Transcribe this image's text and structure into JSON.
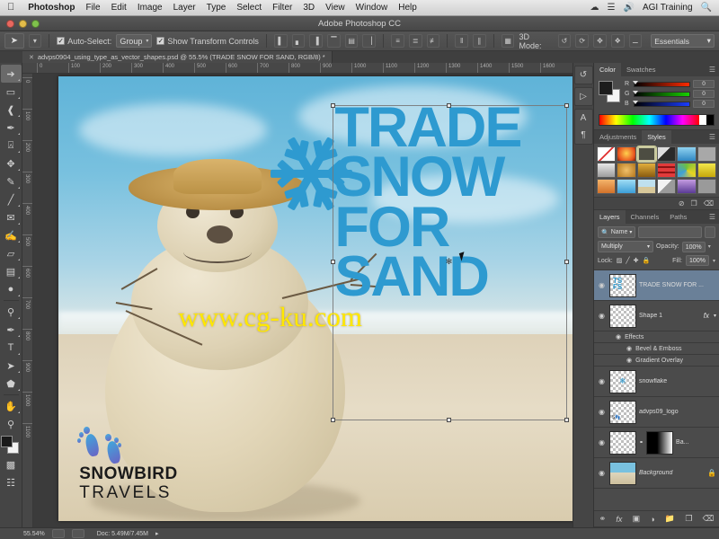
{
  "macbar": {
    "apple_icon": "apple-icon",
    "items": [
      "Photoshop",
      "File",
      "Edit",
      "Image",
      "Layer",
      "Type",
      "Select",
      "Filter",
      "3D",
      "View",
      "Window",
      "Help"
    ],
    "right": {
      "cloud_icon": "cloud-icon",
      "signal_icon": "signal-icon",
      "volume_icon": "volume-icon",
      "user": "AGI Training",
      "search_icon": "search-icon"
    }
  },
  "window": {
    "title": "Adobe Photoshop CC"
  },
  "options_bar": {
    "tool_icon": "move-tool-icon",
    "auto_select_label": "Auto-Select:",
    "auto_select_checked": "✓",
    "group_value": "Group",
    "show_transform_label": "Show Transform Controls",
    "show_transform_checked": "✓",
    "three_d_mode_label": "3D Mode:",
    "workspace": "Essentials"
  },
  "document_tab": {
    "close_icon": "close-icon",
    "title": "advps0904_using_type_as_vector_shapes.psd @ 55.5% (TRADE SNOW FOR SAND, RGB/8) *"
  },
  "rulers": {
    "h_ticks": [
      "0",
      "100",
      "200",
      "300",
      "400",
      "500",
      "600",
      "700",
      "800",
      "900",
      "1000",
      "1100",
      "1200",
      "1300",
      "1400",
      "1500",
      "1600"
    ],
    "v_ticks": [
      "0",
      "100",
      "200",
      "300",
      "400",
      "500",
      "600",
      "700",
      "800",
      "900",
      "1000",
      "1100"
    ]
  },
  "toolbox": {
    "tools": [
      {
        "name": "move-tool",
        "glyph": "➤",
        "active": true
      },
      {
        "name": "marquee-tool",
        "glyph": "▭",
        "active": false
      },
      {
        "name": "lasso-tool",
        "glyph": "⊂",
        "active": false
      },
      {
        "name": "quick-selection-tool",
        "glyph": "✒",
        "active": false
      },
      {
        "name": "crop-tool",
        "glyph": "⌗",
        "active": false
      },
      {
        "name": "eyedropper-tool",
        "glyph": "✒",
        "active": false
      },
      {
        "name": "healing-brush-tool",
        "glyph": "✐",
        "active": false
      },
      {
        "name": "brush-tool",
        "glyph": "╱",
        "active": false
      },
      {
        "name": "clone-stamp-tool",
        "glyph": "⚓",
        "active": false
      },
      {
        "name": "history-brush-tool",
        "glyph": "✎",
        "active": false
      },
      {
        "name": "eraser-tool",
        "glyph": "▱",
        "active": false
      },
      {
        "name": "gradient-tool",
        "glyph": "▤",
        "active": false
      },
      {
        "name": "blur-tool",
        "glyph": "●",
        "active": false
      },
      {
        "name": "dodge-tool",
        "glyph": "⚲",
        "active": false
      },
      {
        "name": "pen-tool",
        "glyph": "✒",
        "active": false
      },
      {
        "name": "type-tool",
        "glyph": "T",
        "active": false
      },
      {
        "name": "path-selection-tool",
        "glyph": "◢",
        "active": false
      },
      {
        "name": "shape-tool",
        "glyph": "⬟",
        "active": false
      },
      {
        "name": "hand-tool",
        "glyph": "✋",
        "active": false
      },
      {
        "name": "zoom-tool",
        "glyph": "⚲",
        "active": false
      }
    ],
    "quick_mask_icon": "quick-mask-icon",
    "screen_mode_icon": "screen-mode-icon"
  },
  "artwork": {
    "headline_lines": [
      "TRADE",
      "SNOW",
      "FOR",
      "SAND"
    ],
    "headline_color": "#2e9ad0",
    "snowflake_icon": "snowflake-icon",
    "logo_line1": "SNOWBIRD",
    "logo_line2": "TRAVELS",
    "watermark": "www.cg-ku.com",
    "watermark_color": "#ffe800",
    "cursor_icon": "arrow-cursor-icon"
  },
  "dock": {
    "icons": [
      {
        "name": "history-icon",
        "glyph": "↺"
      },
      {
        "name": "actions-icon",
        "glyph": "▶"
      },
      {
        "name": "character-icon",
        "glyph": "A"
      },
      {
        "name": "paragraph-icon",
        "glyph": "¶"
      }
    ]
  },
  "color_panel": {
    "tabs": [
      {
        "label": "Color",
        "active": true
      },
      {
        "label": "Swatches",
        "active": false
      }
    ],
    "menu_icon": "panel-menu-icon",
    "channels": [
      {
        "label": "R",
        "value": "0"
      },
      {
        "label": "G",
        "value": "0"
      },
      {
        "label": "B",
        "value": "0"
      }
    ],
    "foreground_color": "#1c1c1c",
    "background_color": "#f4f4f4"
  },
  "styles_panel": {
    "tabs": [
      {
        "label": "Adjustments",
        "active": false
      },
      {
        "label": "Styles",
        "active": true
      }
    ],
    "menu_icon": "panel-menu-icon",
    "swatches": [
      "none",
      "#e8531f",
      "#c9c9a0",
      "#3a3a3a",
      "#3e9fd8",
      "#a8a8a8",
      "#cfcfcf",
      "#d6a24a",
      "#c8922f",
      "#e23b3b",
      "#6fbf3c",
      "#e8d321",
      "#e78b3c",
      "#63c3e6",
      "#8fb8cc",
      "#dcdcdc",
      "#a06bb5",
      "#9a9a9a"
    ],
    "footer_icons": [
      {
        "name": "clear-style-icon",
        "glyph": "⊘"
      },
      {
        "name": "new-style-icon",
        "glyph": "❐"
      },
      {
        "name": "delete-style-icon",
        "glyph": "🗑"
      }
    ]
  },
  "layers_panel": {
    "tabs": [
      {
        "label": "Layers",
        "active": true
      },
      {
        "label": "Channels",
        "active": false
      },
      {
        "label": "Paths",
        "active": false
      }
    ],
    "menu_icon": "panel-menu-icon",
    "filter_label": "Name",
    "filter_icon": "search-icon",
    "filter_value": "",
    "blend_mode": "Multiply",
    "opacity_label": "Opacity:",
    "opacity_value": "100%",
    "lock_label": "Lock:",
    "lock_icons": [
      {
        "name": "lock-transparency-icon",
        "glyph": "▨"
      },
      {
        "name": "lock-image-icon",
        "glyph": "╱"
      },
      {
        "name": "lock-position-icon",
        "glyph": "✚"
      },
      {
        "name": "lock-all-icon",
        "glyph": "🔒"
      }
    ],
    "fill_label": "Fill:",
    "fill_value": "100%",
    "rows": [
      {
        "name": "TRADE SNOW FOR ...",
        "selected": true,
        "visible": true,
        "thumb": "vector",
        "fx": "",
        "locked": false,
        "italic": false
      },
      {
        "name": "Shape 1",
        "selected": false,
        "visible": true,
        "thumb": "vector",
        "fx": "fx",
        "locked": false,
        "italic": false
      },
      {
        "name": "snowflake",
        "selected": false,
        "visible": true,
        "thumb": "flake",
        "fx": "",
        "locked": false,
        "italic": false
      },
      {
        "name": "advps09_logo",
        "selected": false,
        "visible": true,
        "thumb": "logo",
        "fx": "",
        "locked": false,
        "italic": false
      },
      {
        "name": "Ba...",
        "selected": false,
        "visible": true,
        "thumb": "gradient",
        "fx": "",
        "locked": false,
        "italic": false
      },
      {
        "name": "Background",
        "selected": false,
        "visible": true,
        "thumb": "photo",
        "fx": "",
        "locked": true,
        "italic": true
      }
    ],
    "effects_label": "Effects",
    "effects": [
      "Bevel & Emboss",
      "Gradient Overlay"
    ],
    "footer_icons": [
      {
        "name": "link-layers-icon",
        "glyph": "⚭"
      },
      {
        "name": "layer-style-icon",
        "glyph": "fx"
      },
      {
        "name": "layer-mask-icon",
        "glyph": "▣"
      },
      {
        "name": "adjustment-layer-icon",
        "glyph": "◑"
      },
      {
        "name": "new-group-icon",
        "glyph": "🗀"
      },
      {
        "name": "new-layer-icon",
        "glyph": "❐"
      },
      {
        "name": "delete-layer-icon",
        "glyph": "🗑"
      }
    ]
  },
  "status_bar": {
    "zoom": "55.54%",
    "doc_info": "Doc: 5.49M/7.45M",
    "arrow_icon": "chevron-right-icon"
  }
}
